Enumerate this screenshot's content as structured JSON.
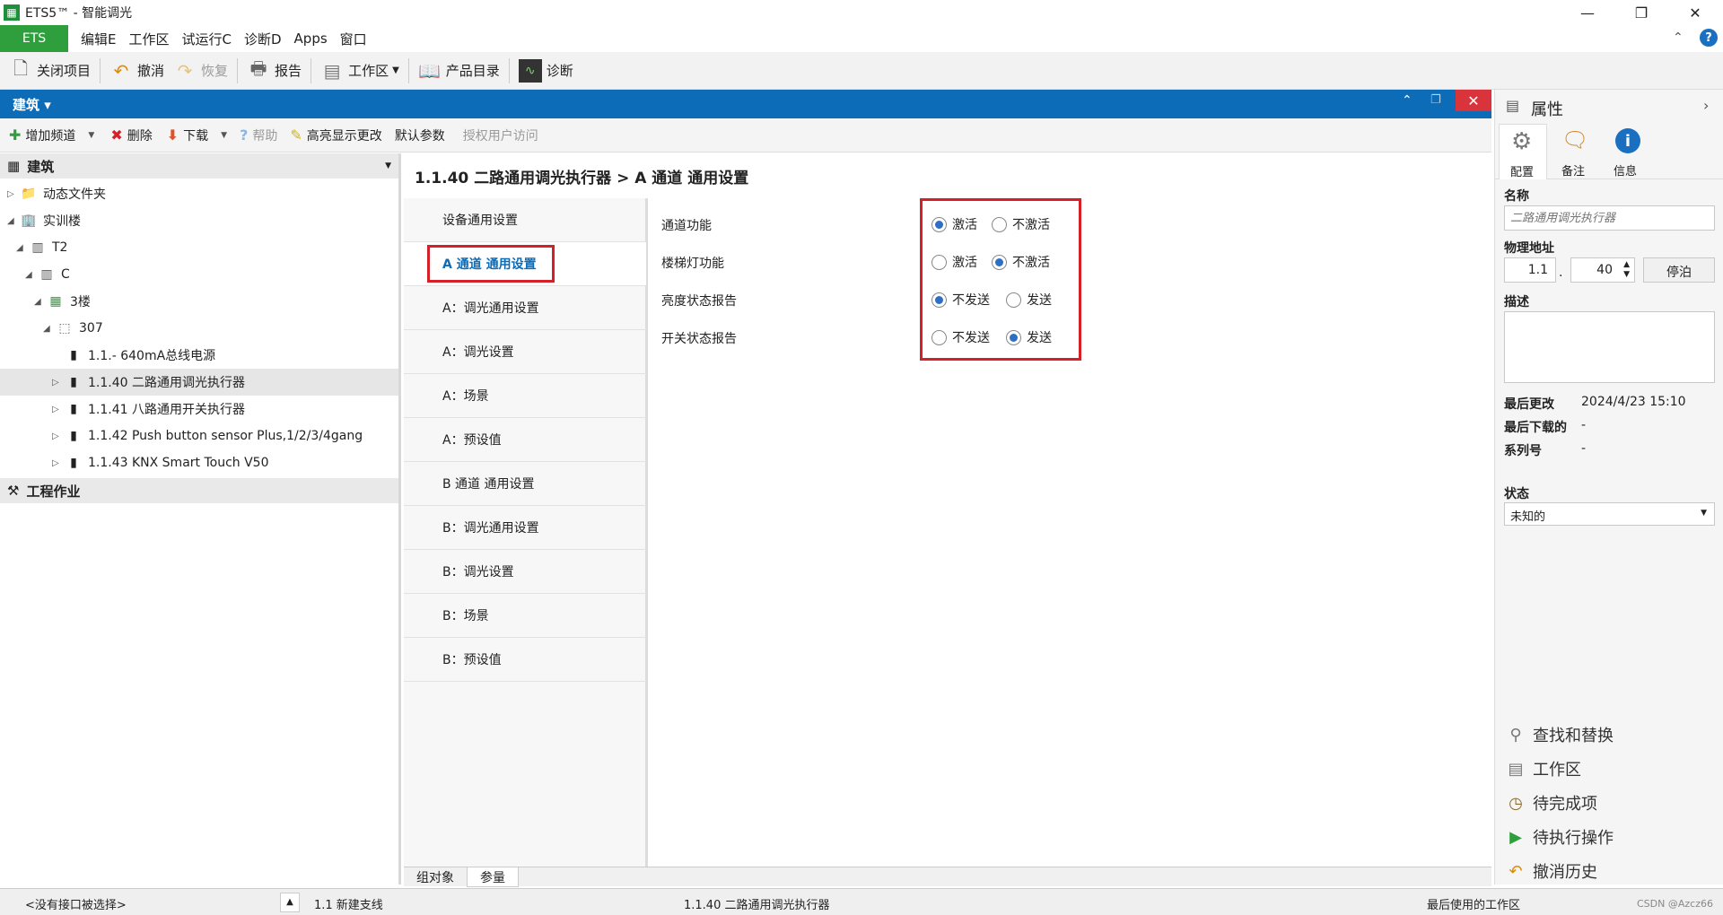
{
  "titlebar": {
    "title": "ETS5™ - 智能调光",
    "min": "—",
    "max": "❐",
    "close": "✕"
  },
  "menubar": {
    "ets": "ETS",
    "items": [
      "编辑E",
      "工作区",
      "试运行C",
      "诊断D",
      "Apps",
      "窗口"
    ]
  },
  "toolbar": {
    "close_project": "关闭项目",
    "undo": "撤消",
    "redo": "恢复",
    "report": "报告",
    "workspace": "工作区",
    "catalog": "产品目录",
    "diagnostics": "诊断"
  },
  "panel": {
    "title": "建筑"
  },
  "toolbar2": {
    "add_channel": "增加频道",
    "delete": "删除",
    "download": "下载",
    "help": "帮助",
    "highlight": "高亮显示更改",
    "default_params": "默认参数",
    "authorize": "授权用户访问"
  },
  "tree": {
    "header": "建筑",
    "rows": [
      {
        "label": "动态文件夹"
      },
      {
        "label": "实训楼"
      },
      {
        "label": "T2"
      },
      {
        "label": "C"
      },
      {
        "label": "3楼"
      },
      {
        "label": "307"
      },
      {
        "label": "1.1.- 640mA总线电源"
      },
      {
        "label": "1.1.40 二路通用调光执行器"
      },
      {
        "label": "1.1.41 八路通用开关执行器"
      },
      {
        "label": "1.1.42 Push button sensor Plus,1/2/3/4gang"
      },
      {
        "label": "1.1.43 KNX Smart Touch V50"
      }
    ],
    "section2": "工程作业"
  },
  "breadcrumb": "1.1.40 二路通用调光执行器 > A 通道 通用设置",
  "nav": [
    "设备通用设置",
    "A 通道 通用设置",
    "A：调光通用设置",
    "A：调光设置",
    "A：场景",
    "A：预设值",
    "B 通道 通用设置",
    "B：调光通用设置",
    "B：调光设置",
    "B：场景",
    "B：预设值"
  ],
  "params": [
    {
      "label": "通道功能",
      "opt1": "激活",
      "opt2": "不激活",
      "selected": 1
    },
    {
      "label": "楼梯灯功能",
      "opt1": "激活",
      "opt2": "不激活",
      "selected": 2
    },
    {
      "label": "亮度状态报告",
      "opt1": "不发送",
      "opt2": "发送",
      "selected": 1
    },
    {
      "label": "开关状态报告",
      "opt1": "不发送",
      "opt2": "发送",
      "selected": 2
    }
  ],
  "bottom_tabs": [
    "组对象",
    "参量"
  ],
  "properties": {
    "title": "属性",
    "tabs": [
      "配置",
      "备注",
      "信息"
    ],
    "name_label": "名称",
    "name_placeholder": "二路通用调光执行器",
    "phys_label": "物理地址",
    "phys_area": "1.1",
    "phys_dev": "40",
    "park_button": "停泊",
    "desc_label": "描述",
    "last_modified_label": "最后更改",
    "last_modified": "2024/4/23 15:10",
    "last_download_label": "最后下载的",
    "last_download": "-",
    "serial_label": "系列号",
    "serial": "-",
    "status_label": "状态",
    "status_value": "未知的",
    "links": [
      "查找和替换",
      "工作区",
      "待完成项",
      "待执行操作",
      "撤消历史"
    ]
  },
  "statusbar": {
    "interface": "<没有接口被选择>",
    "line": "1.1 新建支线",
    "device": "1.1.40 二路通用调光执行器",
    "workspace": "最后使用的工作区",
    "watermark": "CSDN @Azcz66"
  },
  "colors": {
    "accent": "#0d6cb8",
    "ets_green": "#2f9e3c",
    "highlight_red": "#d42027"
  }
}
